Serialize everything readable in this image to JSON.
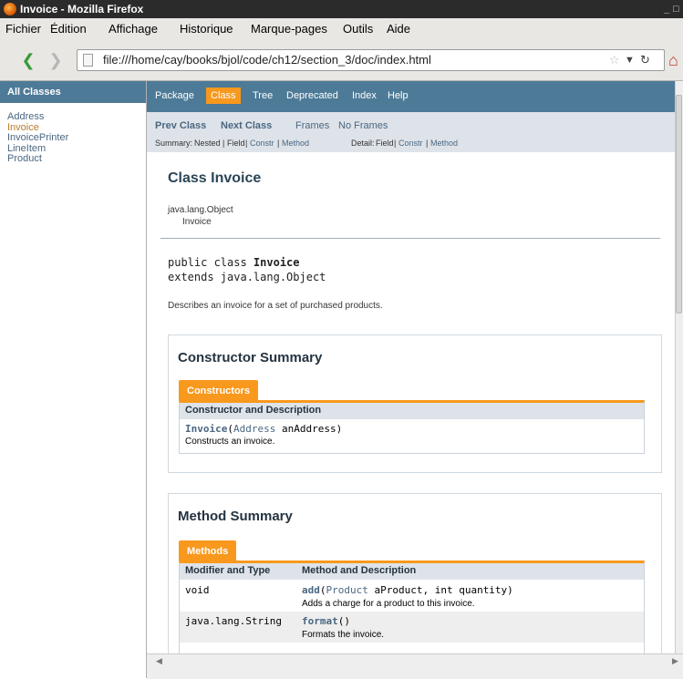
{
  "window": {
    "title": "Invoice - Mozilla Firefox",
    "controls": [
      "_",
      "□",
      "x"
    ]
  },
  "menubar": [
    "Fichier",
    "Édition",
    "Affichage",
    "Historique",
    "Marque-pages",
    "Outils",
    "Aide"
  ],
  "navigation": {
    "url": "file:///home/cay/books/bjol/code/ch12/section_3/doc/index.html",
    "back_icon": "back-arrow-icon",
    "forward_icon": "forward-arrow-icon",
    "bookmark_icon": "star-icon",
    "reload_icon": "reload-icon",
    "home_icon": "home-icon"
  },
  "left_frame": {
    "header": "All Classes",
    "classes": [
      "Address",
      "Invoice",
      "InvoicePrinter",
      "LineItem",
      "Product"
    ],
    "current": "Invoice"
  },
  "top_nav": {
    "items": [
      "Package",
      "Class",
      "Tree",
      "Deprecated",
      "Index",
      "Help"
    ],
    "active": "Class"
  },
  "sub_nav": {
    "prev": "Prev Class",
    "next": "Next Class",
    "frames": "Frames",
    "no_frames": "No Frames",
    "summary_label": "Summary:",
    "summary_nested": "Nested",
    "summary_field": "Field",
    "summary_constr": "Constr",
    "summary_method": "Method",
    "detail_label": "Detail:",
    "detail_field": "Field",
    "detail_constr": "Constr",
    "detail_method": "Method",
    "sep": "|"
  },
  "class_info": {
    "title": "Class Invoice",
    "hierarchy_parent": "java.lang.Object",
    "hierarchy_child": "Invoice",
    "declaration_prefix": "public class ",
    "declaration_name": "Invoice",
    "extends_line": "extends java.lang.Object",
    "description": "Describes an invoice for a set of purchased products."
  },
  "constructor_summary": {
    "title": "Constructor Summary",
    "tab": "Constructors",
    "header": "Constructor and Description",
    "rows": [
      {
        "name": "Invoice",
        "open": "(",
        "param_type": "Address",
        "param_rest": " anAddress)",
        "description": "Constructs an invoice."
      }
    ]
  },
  "method_summary": {
    "title": "Method Summary",
    "tab": "Methods",
    "header_modifier": "Modifier and Type",
    "header_method": "Method and Description",
    "rows": [
      {
        "modifier": "void",
        "name": "add",
        "open": "(",
        "param_type": "Product",
        "param_rest": " aProduct, int quantity)",
        "description": "Adds a charge for a product to this invoice."
      },
      {
        "modifier": "java.lang.String",
        "name": "format",
        "open": "()",
        "param_type": "",
        "param_rest": "",
        "description": "Formats the invoice."
      }
    ]
  },
  "colors": {
    "nav_blue": "#4d7a97",
    "active_orange": "#f8981d",
    "subnav_bg": "#dee3e9",
    "link": "#4a6782"
  }
}
